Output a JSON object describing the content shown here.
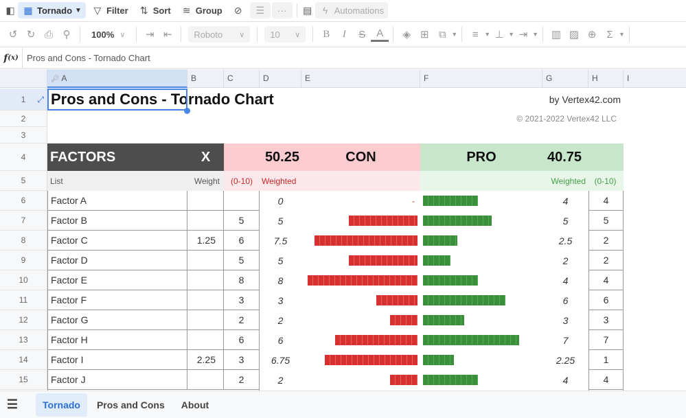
{
  "toolbar": {
    "sidebar_icon": "sidebar-toggle-icon",
    "view_name": "Tornado",
    "filter_label": "Filter",
    "sort_label": "Sort",
    "group_label": "Group",
    "automations_label": "Automations"
  },
  "format_toolbar": {
    "zoom": "100%",
    "font": "Roboto",
    "font_size": "10"
  },
  "formula_bar": {
    "fx_label": "f(x)",
    "value": "Pros and Cons - Tornado Chart"
  },
  "columns": [
    "A",
    "B",
    "C",
    "D",
    "E",
    "F",
    "G",
    "H",
    "I"
  ],
  "rows": [
    "1",
    "2",
    "3",
    "4",
    "5",
    "6",
    "7",
    "8",
    "9",
    "10",
    "11",
    "12",
    "13",
    "14",
    "15"
  ],
  "sheet": {
    "title": "Pros and Cons - Tornado Chart",
    "byline": "by Vertex42.com",
    "copyright": "© 2021-2022 Vertex42 LLC",
    "header": {
      "factors": "FACTORS",
      "x": "X",
      "con_total": "50.25",
      "con_label": "CON",
      "pro_label": "PRO",
      "pro_total": "40.75"
    },
    "subheader": {
      "list": "List",
      "weight": "Weight",
      "con_range": "(0-10)",
      "con_weighted": "Weighted",
      "pro_weighted": "Weighted",
      "pro_range": "(0-10)"
    },
    "colors": {
      "con_bar": "#d63030",
      "pro_bar": "#3a8f3a",
      "header_dark": "#4d4d4d",
      "con_header": "#fdccd0",
      "pro_header": "#c8e6c9"
    },
    "factors": [
      {
        "name": "Factor A",
        "weight": "",
        "con": "",
        "con_weighted": "0",
        "pro_weighted": "4",
        "pro": "4",
        "con_v": 0,
        "pro_v": 4
      },
      {
        "name": "Factor B",
        "weight": "",
        "con": "5",
        "con_weighted": "5",
        "pro_weighted": "5",
        "pro": "5",
        "con_v": 5,
        "pro_v": 5
      },
      {
        "name": "Factor C",
        "weight": "1.25",
        "con": "6",
        "con_weighted": "7.5",
        "pro_weighted": "2.5",
        "pro": "2",
        "con_v": 7.5,
        "pro_v": 2.5
      },
      {
        "name": "Factor D",
        "weight": "",
        "con": "5",
        "con_weighted": "5",
        "pro_weighted": "2",
        "pro": "2",
        "con_v": 5,
        "pro_v": 2
      },
      {
        "name": "Factor E",
        "weight": "",
        "con": "8",
        "con_weighted": "8",
        "pro_weighted": "4",
        "pro": "4",
        "con_v": 8,
        "pro_v": 4
      },
      {
        "name": "Factor F",
        "weight": "",
        "con": "3",
        "con_weighted": "3",
        "pro_weighted": "6",
        "pro": "6",
        "con_v": 3,
        "pro_v": 6
      },
      {
        "name": "Factor G",
        "weight": "",
        "con": "2",
        "con_weighted": "2",
        "pro_weighted": "3",
        "pro": "3",
        "con_v": 2,
        "pro_v": 3
      },
      {
        "name": "Factor H",
        "weight": "",
        "con": "6",
        "con_weighted": "6",
        "pro_weighted": "7",
        "pro": "7",
        "con_v": 6,
        "pro_v": 7
      },
      {
        "name": "Factor I",
        "weight": "2.25",
        "con": "3",
        "con_weighted": "6.75",
        "pro_weighted": "2.25",
        "pro": "1",
        "con_v": 6.75,
        "pro_v": 2.25
      },
      {
        "name": "Factor J",
        "weight": "",
        "con": "2",
        "con_weighted": "2",
        "pro_weighted": "4",
        "pro": "4",
        "con_v": 2,
        "pro_v": 4
      }
    ],
    "zero_marker": "-"
  },
  "tabs": [
    {
      "label": "Tornado",
      "active": true
    },
    {
      "label": "Pros and Cons",
      "active": false
    },
    {
      "label": "About",
      "active": false
    }
  ]
}
